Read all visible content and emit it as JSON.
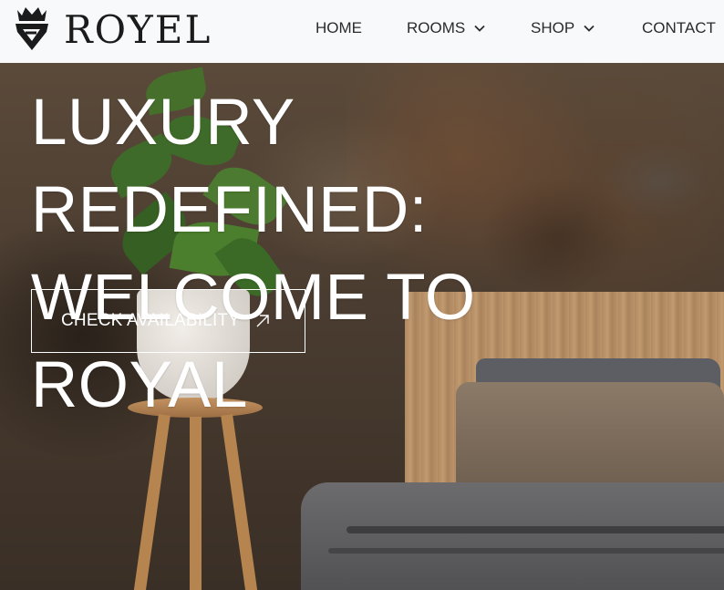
{
  "brand": {
    "name": "ROYEL",
    "logo_icon": "crown-shield-icon"
  },
  "nav": {
    "items": [
      {
        "label": "HOME",
        "has_dropdown": false
      },
      {
        "label": "ROOMS",
        "has_dropdown": true,
        "icon": "chevron-down-icon"
      },
      {
        "label": "SHOP",
        "has_dropdown": true,
        "icon": "chevron-down-icon"
      },
      {
        "label": "CONTACT",
        "has_dropdown": false
      }
    ]
  },
  "hero": {
    "title_line1": "LUXURY REDEFINED:",
    "title_line2": "WELCOME TO ROYAL",
    "cta_label": "CHECK AVAILABILITY",
    "cta_icon": "arrow-up-right-icon"
  },
  "colors": {
    "header_bg": "#f8f9fa",
    "text_dark": "#1b1b1b",
    "hero_text": "#ffffff"
  }
}
